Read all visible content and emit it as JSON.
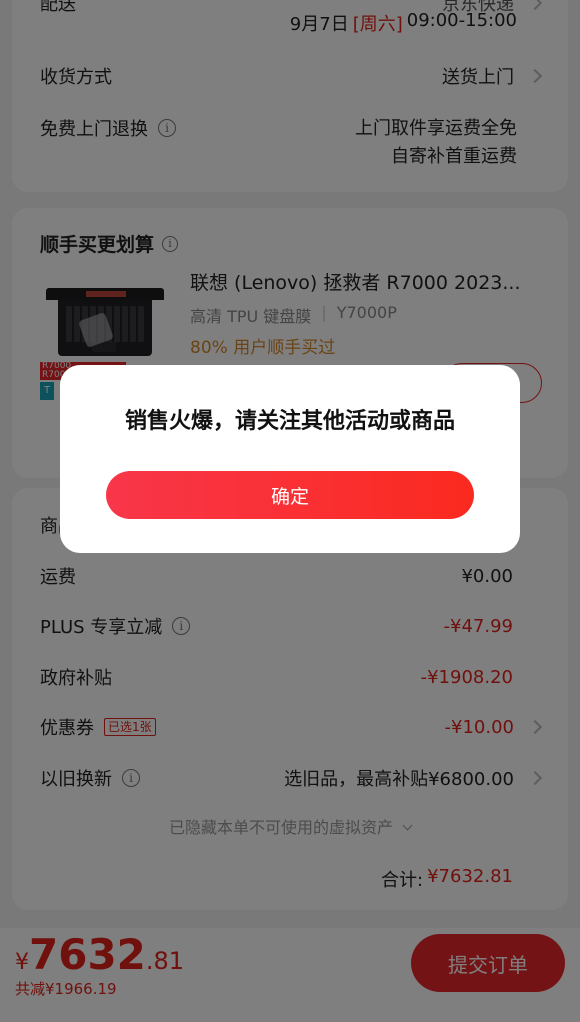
{
  "delivery": {
    "top_label": "配送",
    "top_value": "京东快递",
    "date_prefix": "9月7日",
    "weekday": "[周六]",
    "time_range": "09:00-15:00",
    "receive_label": "收货方式",
    "receive_value": "送货上门",
    "return_label": "免费上门退换",
    "return_line1": "上门取件享运费全免",
    "return_line2": "自寄补首重运费"
  },
  "addon": {
    "title": "顺手买更划算",
    "product_name": "联想 (Lenovo) 拯救者 R7000 2023...",
    "spec": "高清 TPU 键盘膜",
    "spec_model": "Y7000P",
    "promo": "80% 用户顺手买过",
    "thumb_tag1": "R7000",
    "thumb_tag2": "R7000",
    "thumb_tag3": "T"
  },
  "price": {
    "goods_label": "商品金额",
    "shipping_label": "运费",
    "shipping_value": "¥0.00",
    "plus_label": "PLUS 专享立减",
    "plus_value": "-¥47.99",
    "gov_label": "政府补贴",
    "gov_value": "-¥1908.20",
    "coupon_label": "优惠券",
    "coupon_badge": "已选1张",
    "coupon_value": "-¥10.00",
    "tradein_label": "以旧换新",
    "tradein_value": "选旧品，最高补贴¥6800.00",
    "hidden_assets": "已隐藏本单不可使用的虚拟资产",
    "total_label": "合计:",
    "total_value": "¥7632.81"
  },
  "bottom": {
    "currency": "¥",
    "amount_int": "7632",
    "amount_dec": ".81",
    "saved": "共减¥1966.19",
    "submit": "提交订单"
  },
  "dialog": {
    "message": "销售火爆，请关注其他活动或商品",
    "confirm": "确定"
  },
  "colors": {
    "accent": "#e2231a",
    "button_gradient_start": "#f8364a",
    "button_gradient_end": "#fb2a1f"
  }
}
